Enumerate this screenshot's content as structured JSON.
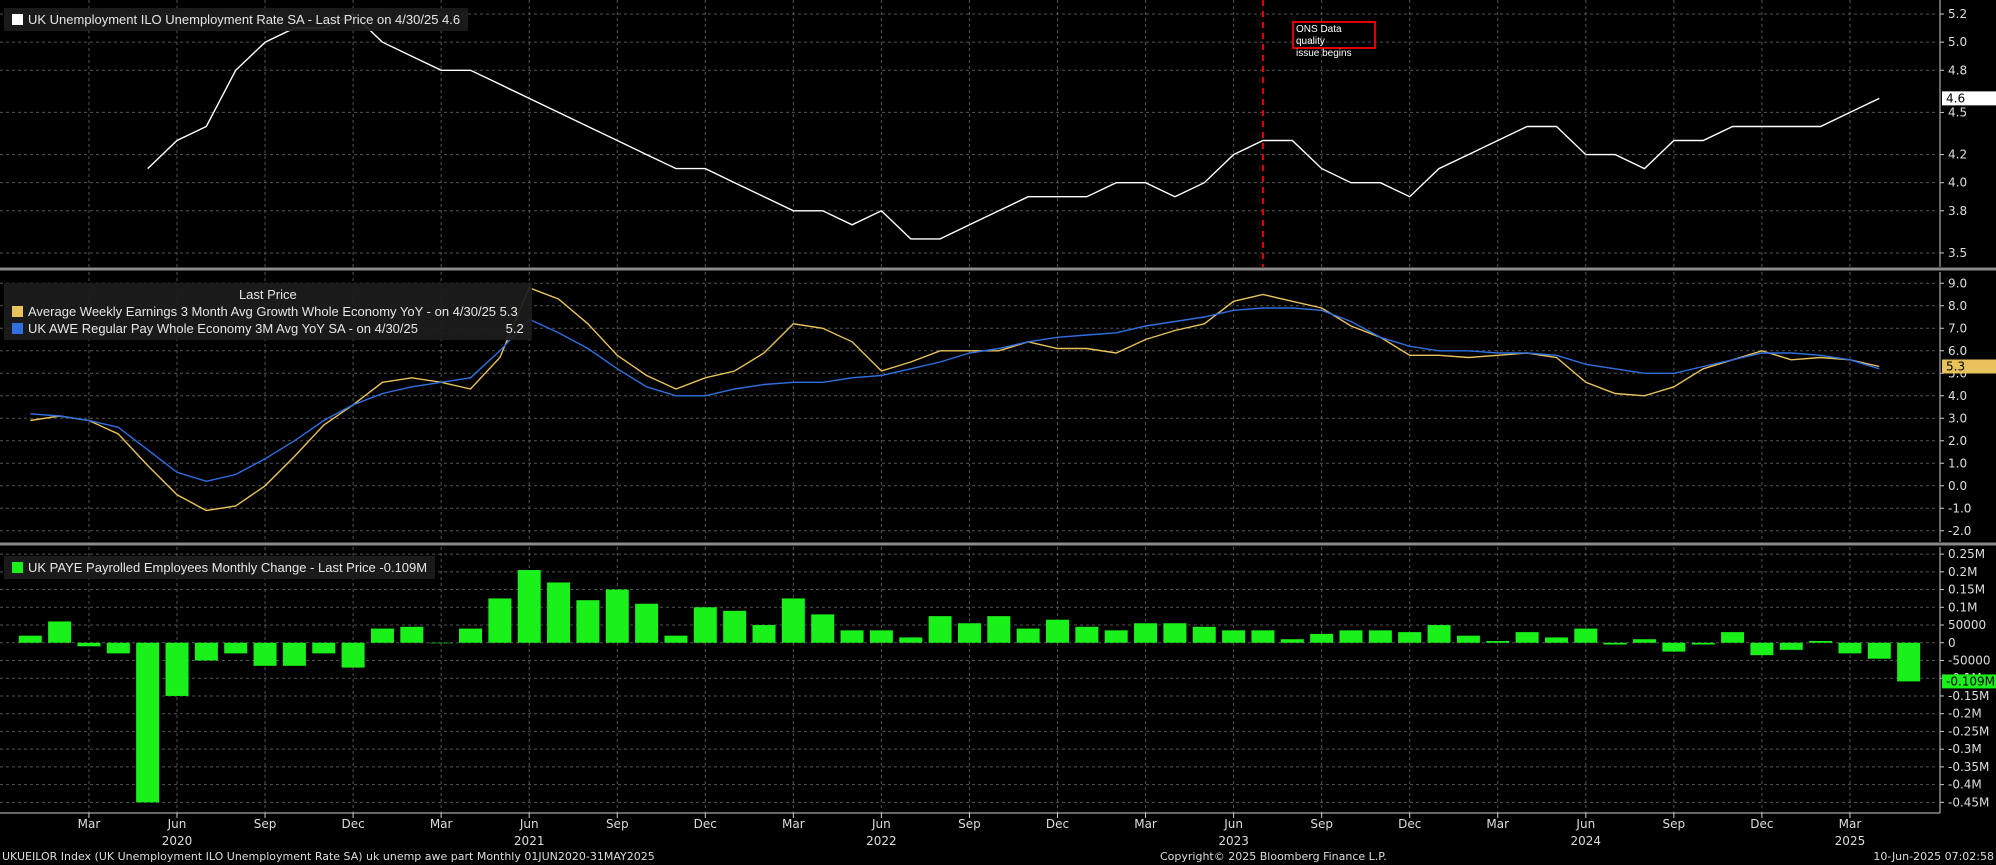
{
  "footer": {
    "left": "UKUEILOR Index (UK Unemployment ILO Unemployment Rate SA) uk unemp awe part  Monthly 01JUN2020-31MAY2025",
    "center": "Copyright© 2025 Bloomberg Finance L.P.",
    "right": "10-Jun-2025 07:02:58"
  },
  "annotation": {
    "line1": "ONS Data quality",
    "line2": "issue begins",
    "date": "2023-07-31",
    "color": "#e00000"
  },
  "colors": {
    "unemployment": "#ffffff",
    "awe": "#e8c25a",
    "regular_pay": "#2f6fe0",
    "paye": "#1af01a",
    "grid": "#555555"
  },
  "chart_data": [
    {
      "type": "line",
      "legend": [
        {
          "label": "UK Unemployment ILO Unemployment Rate SA - Last Price on 4/30/25 4.6"
        }
      ],
      "last_value_label": "4.6",
      "ylim": [
        3.4,
        5.3
      ],
      "y_ticks": [
        "3.5",
        "3.8",
        "4.0",
        "4.2",
        "4.5",
        "4.8",
        "5.0",
        "5.2"
      ],
      "series": [
        {
          "x": [
            "2020-05",
            "2020-06",
            "2020-07",
            "2020-08",
            "2020-09",
            "2020-10",
            "2020-11",
            "2020-12",
            "2021-01",
            "2021-02",
            "2021-03",
            "2021-04",
            "2021-05",
            "2021-06",
            "2021-07",
            "2021-08",
            "2021-09",
            "2021-10",
            "2021-11",
            "2021-12",
            "2022-01",
            "2022-02",
            "2022-03",
            "2022-04",
            "2022-05",
            "2022-06",
            "2022-07",
            "2022-08",
            "2022-09",
            "2022-10",
            "2022-11",
            "2022-12",
            "2023-01",
            "2023-02",
            "2023-03",
            "2023-04",
            "2023-05",
            "2023-06",
            "2023-07",
            "2023-08",
            "2023-09",
            "2023-10",
            "2023-11",
            "2023-12",
            "2024-01",
            "2024-02",
            "2024-03",
            "2024-04",
            "2024-05",
            "2024-06",
            "2024-07",
            "2024-08",
            "2024-09",
            "2024-10",
            "2024-11",
            "2024-12",
            "2025-01",
            "2025-02",
            "2025-03",
            "2025-04"
          ],
          "values": [
            4.1,
            4.3,
            4.4,
            4.8,
            5.0,
            5.1,
            5.1,
            5.2,
            5.0,
            4.9,
            4.8,
            4.8,
            4.7,
            4.6,
            4.5,
            4.4,
            4.3,
            4.2,
            4.1,
            4.1,
            4.0,
            3.9,
            3.8,
            3.8,
            3.7,
            3.8,
            3.6,
            3.6,
            3.7,
            3.8,
            3.9,
            3.9,
            3.9,
            4.0,
            4.0,
            3.9,
            4.0,
            4.2,
            4.3,
            4.3,
            4.1,
            4.0,
            4.0,
            3.9,
            4.1,
            4.2,
            4.3,
            4.4,
            4.4,
            4.2,
            4.2,
            4.1,
            4.3,
            4.3,
            4.4,
            4.4,
            4.4,
            4.4,
            4.5,
            4.6
          ]
        }
      ]
    },
    {
      "type": "line",
      "legend_header": "Last Price",
      "legend": [
        {
          "label": "Average Weekly Earnings 3 Month Avg Growth Whole Economy YoY -  on 4/30/25",
          "value": "5.3"
        },
        {
          "label": "UK AWE Regular Pay Whole Economy 3M Avg YoY SA -  on 4/30/25",
          "value": "5.2"
        }
      ],
      "last_value_label": "5.3",
      "ylim": [
        -2.5,
        9.5
      ],
      "y_ticks": [
        "-2.0",
        "-1.0",
        "0.0",
        "1.0",
        "2.0",
        "3.0",
        "4.0",
        "5.0",
        "6.0",
        "7.0",
        "8.0",
        "9.0"
      ],
      "series": [
        {
          "name": "Average Weekly Earnings 3 Month Avg Growth Whole Economy YoY",
          "x": [
            "2020-01",
            "2020-02",
            "2020-03",
            "2020-04",
            "2020-05",
            "2020-06",
            "2020-07",
            "2020-08",
            "2020-09",
            "2020-10",
            "2020-11",
            "2020-12",
            "2021-01",
            "2021-02",
            "2021-03",
            "2021-04",
            "2021-05",
            "2021-06",
            "2021-07",
            "2021-08",
            "2021-09",
            "2021-10",
            "2021-11",
            "2021-12",
            "2022-01",
            "2022-02",
            "2022-03",
            "2022-04",
            "2022-05",
            "2022-06",
            "2022-07",
            "2022-08",
            "2022-09",
            "2022-10",
            "2022-11",
            "2022-12",
            "2023-01",
            "2023-02",
            "2023-03",
            "2023-04",
            "2023-05",
            "2023-06",
            "2023-07",
            "2023-08",
            "2023-09",
            "2023-10",
            "2023-11",
            "2023-12",
            "2024-01",
            "2024-02",
            "2024-03",
            "2024-04",
            "2024-05",
            "2024-06",
            "2024-07",
            "2024-08",
            "2024-09",
            "2024-10",
            "2024-11",
            "2024-12",
            "2025-01",
            "2025-02",
            "2025-03",
            "2025-04"
          ],
          "values": [
            2.9,
            3.1,
            2.9,
            2.3,
            0.9,
            -0.4,
            -1.1,
            -0.9,
            0.0,
            1.3,
            2.7,
            3.6,
            4.6,
            4.8,
            4.6,
            4.3,
            5.7,
            8.8,
            8.3,
            7.2,
            5.8,
            4.9,
            4.3,
            4.8,
            5.1,
            5.9,
            7.2,
            7.0,
            6.4,
            5.1,
            5.5,
            6.0,
            6.0,
            6.0,
            6.4,
            6.1,
            6.1,
            5.9,
            6.5,
            6.9,
            7.2,
            8.2,
            8.5,
            8.2,
            7.9,
            7.1,
            6.6,
            5.8,
            5.8,
            5.7,
            5.8,
            5.9,
            5.7,
            4.6,
            4.1,
            4.0,
            4.4,
            5.2,
            5.6,
            6.0,
            5.6,
            5.7,
            5.6,
            5.3
          ]
        },
        {
          "name": "UK AWE Regular Pay Whole Economy 3M Avg YoY SA",
          "x": [
            "2020-01",
            "2020-02",
            "2020-03",
            "2020-04",
            "2020-05",
            "2020-06",
            "2020-07",
            "2020-08",
            "2020-09",
            "2020-10",
            "2020-11",
            "2020-12",
            "2021-01",
            "2021-02",
            "2021-03",
            "2021-04",
            "2021-05",
            "2021-06",
            "2021-07",
            "2021-08",
            "2021-09",
            "2021-10",
            "2021-11",
            "2021-12",
            "2022-01",
            "2022-02",
            "2022-03",
            "2022-04",
            "2022-05",
            "2022-06",
            "2022-07",
            "2022-08",
            "2022-09",
            "2022-10",
            "2022-11",
            "2022-12",
            "2023-01",
            "2023-02",
            "2023-03",
            "2023-04",
            "2023-05",
            "2023-06",
            "2023-07",
            "2023-08",
            "2023-09",
            "2023-10",
            "2023-11",
            "2023-12",
            "2024-01",
            "2024-02",
            "2024-03",
            "2024-04",
            "2024-05",
            "2024-06",
            "2024-07",
            "2024-08",
            "2024-09",
            "2024-10",
            "2024-11",
            "2024-12",
            "2025-01",
            "2025-02",
            "2025-03",
            "2025-04"
          ],
          "values": [
            3.2,
            3.1,
            2.9,
            2.6,
            1.6,
            0.6,
            0.2,
            0.5,
            1.2,
            2.0,
            2.9,
            3.6,
            4.1,
            4.4,
            4.6,
            4.8,
            6.0,
            7.4,
            6.8,
            6.1,
            5.2,
            4.4,
            4.0,
            4.0,
            4.3,
            4.5,
            4.6,
            4.6,
            4.8,
            4.9,
            5.2,
            5.5,
            5.9,
            6.1,
            6.4,
            6.6,
            6.7,
            6.8,
            7.1,
            7.3,
            7.5,
            7.8,
            7.9,
            7.9,
            7.8,
            7.3,
            6.6,
            6.2,
            6.0,
            6.0,
            5.9,
            5.9,
            5.8,
            5.4,
            5.2,
            5.0,
            5.0,
            5.3,
            5.6,
            5.9,
            5.9,
            5.8,
            5.6,
            5.2
          ]
        }
      ]
    },
    {
      "type": "bar",
      "legend": [
        {
          "label": "UK PAYE Payrolled Employees Monthly Change - Last Price -0.109M"
        }
      ],
      "last_value_label": "-0.109M",
      "ylim": [
        -0.48,
        0.27
      ],
      "y_ticks": [
        "-0.45M",
        "-0.4M",
        "-0.35M",
        "-0.3M",
        "-0.25M",
        "-0.2M",
        "-0.15M",
        "-0.1M",
        "-50000",
        "0",
        "50000",
        "0.1M",
        "0.15M",
        "0.2M",
        "0.25M"
      ],
      "x": [
        "2020-01",
        "2020-02",
        "2020-03",
        "2020-04",
        "2020-05",
        "2020-06",
        "2020-07",
        "2020-08",
        "2020-09",
        "2020-10",
        "2020-11",
        "2020-12",
        "2021-01",
        "2021-02",
        "2021-03",
        "2021-04",
        "2021-05",
        "2021-06",
        "2021-07",
        "2021-08",
        "2021-09",
        "2021-10",
        "2021-11",
        "2021-12",
        "2022-01",
        "2022-02",
        "2022-03",
        "2022-04",
        "2022-05",
        "2022-06",
        "2022-07",
        "2022-08",
        "2022-09",
        "2022-10",
        "2022-11",
        "2022-12",
        "2023-01",
        "2023-02",
        "2023-03",
        "2023-04",
        "2023-05",
        "2023-06",
        "2023-07",
        "2023-08",
        "2023-09",
        "2023-10",
        "2023-11",
        "2023-12",
        "2024-01",
        "2024-02",
        "2024-03",
        "2024-04",
        "2024-05",
        "2024-06",
        "2024-07",
        "2024-08",
        "2024-09",
        "2024-10",
        "2024-11",
        "2024-12",
        "2025-01",
        "2025-02",
        "2025-03",
        "2025-04",
        "2025-05"
      ],
      "values": [
        0.02,
        0.06,
        -0.01,
        -0.03,
        -0.45,
        -0.15,
        -0.05,
        -0.03,
        -0.065,
        -0.065,
        -0.03,
        -0.07,
        0.04,
        0.045,
        0.0,
        0.04,
        0.125,
        0.205,
        0.17,
        0.12,
        0.15,
        0.11,
        0.02,
        0.1,
        0.09,
        0.05,
        0.125,
        0.08,
        0.035,
        0.035,
        0.015,
        0.075,
        0.055,
        0.075,
        0.04,
        0.065,
        0.045,
        0.035,
        0.055,
        0.055,
        0.045,
        0.035,
        0.035,
        0.01,
        0.025,
        0.035,
        0.035,
        0.03,
        0.05,
        0.02,
        0.005,
        0.03,
        0.015,
        0.04,
        -0.005,
        0.01,
        -0.025,
        -0.005,
        0.03,
        -0.035,
        -0.02,
        0.005,
        -0.03,
        -0.045,
        -0.109
      ]
    }
  ],
  "x_axis": {
    "month_ticks": [
      {
        "date": "2020-03",
        "label": "Mar"
      },
      {
        "date": "2020-06",
        "label": "Jun"
      },
      {
        "date": "2020-09",
        "label": "Sep"
      },
      {
        "date": "2020-12",
        "label": "Dec"
      },
      {
        "date": "2021-03",
        "label": "Mar"
      },
      {
        "date": "2021-06",
        "label": "Jun"
      },
      {
        "date": "2021-09",
        "label": "Sep"
      },
      {
        "date": "2021-12",
        "label": "Dec"
      },
      {
        "date": "2022-03",
        "label": "Mar"
      },
      {
        "date": "2022-06",
        "label": "Jun"
      },
      {
        "date": "2022-09",
        "label": "Sep"
      },
      {
        "date": "2022-12",
        "label": "Dec"
      },
      {
        "date": "2023-03",
        "label": "Mar"
      },
      {
        "date": "2023-06",
        "label": "Jun"
      },
      {
        "date": "2023-09",
        "label": "Sep"
      },
      {
        "date": "2023-12",
        "label": "Dec"
      },
      {
        "date": "2024-03",
        "label": "Mar"
      },
      {
        "date": "2024-06",
        "label": "Jun"
      },
      {
        "date": "2024-09",
        "label": "Sep"
      },
      {
        "date": "2024-12",
        "label": "Dec"
      },
      {
        "date": "2025-03",
        "label": "Mar"
      }
    ],
    "year_ticks": [
      {
        "date": "2020-06",
        "label": "2020"
      },
      {
        "date": "2021-06",
        "label": "2021"
      },
      {
        "date": "2022-06",
        "label": "2022"
      },
      {
        "date": "2023-06",
        "label": "2023"
      },
      {
        "date": "2024-06",
        "label": "2024"
      },
      {
        "date": "2025-03",
        "label": "2025"
      }
    ]
  }
}
